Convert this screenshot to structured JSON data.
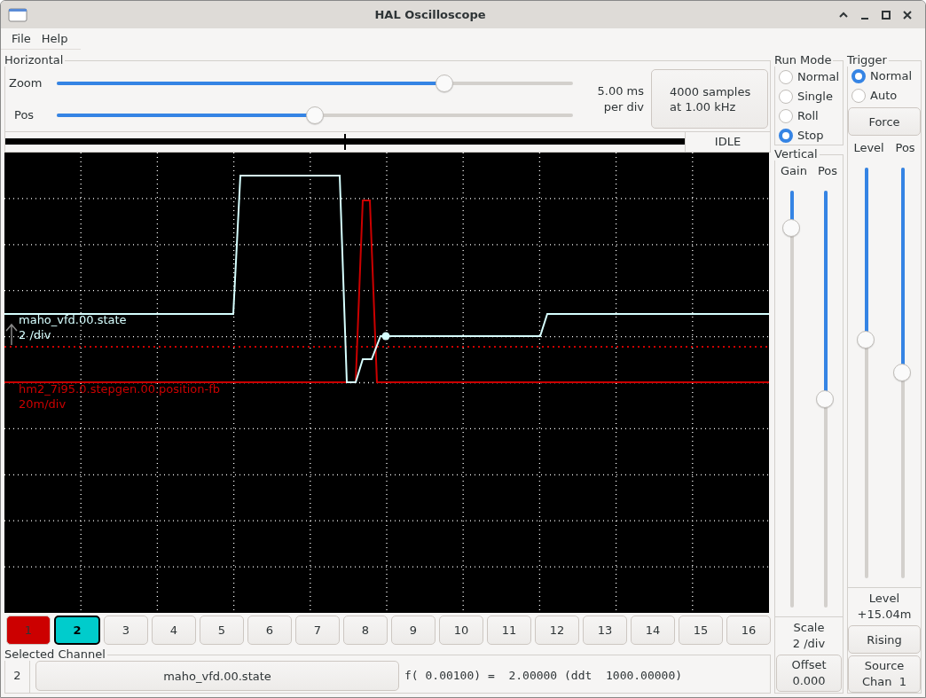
{
  "window": {
    "title": "HAL Oscilloscope"
  },
  "menu": [
    "File",
    "Help"
  ],
  "horizontal": {
    "title": "Horizontal",
    "sliders": [
      {
        "label": "Zoom",
        "level": 0.75
      },
      {
        "label": "Pos",
        "level": 0.5
      }
    ],
    "scale": "5.00 ms\nper div",
    "samples_button": "4000 samples\nat 1.00 kHz"
  },
  "status": "IDLE",
  "capture": {
    "level": 1
  },
  "traces": [
    {
      "name": "maho_vfd.00.state",
      "scale": "2 /div",
      "color": "#d6ffff"
    },
    {
      "name": "hm2_7i95.0.stepgen.00.position-fb",
      "scale": "20m/div",
      "color": "#cc0000"
    }
  ],
  "channels": [
    {
      "label": "1",
      "color": "#cc0000",
      "selected": false
    },
    {
      "label": "2",
      "color": "#00cccc",
      "selected": true
    },
    {
      "label": "3",
      "selected": false
    },
    {
      "label": "4",
      "selected": false
    },
    {
      "label": "5",
      "selected": false
    },
    {
      "label": "6",
      "selected": false
    },
    {
      "label": "7",
      "selected": false
    },
    {
      "label": "8",
      "selected": false
    },
    {
      "label": "9",
      "selected": false
    },
    {
      "label": "10",
      "selected": false
    },
    {
      "label": "11",
      "selected": false
    },
    {
      "label": "12",
      "selected": false
    },
    {
      "label": "13",
      "selected": false
    },
    {
      "label": "14",
      "selected": false
    },
    {
      "label": "15",
      "selected": false
    },
    {
      "label": "16",
      "selected": false
    }
  ],
  "selected_channel": {
    "title": "Selected Channel",
    "number": "2",
    "name_button": "maho_vfd.00.state",
    "readout": "f( 0.00100) =  2.00000 (ddt  1000.00000)"
  },
  "run_mode": {
    "title": "Run Mode",
    "options": [
      {
        "label": "Normal",
        "selected": false
      },
      {
        "label": "Single",
        "selected": false
      },
      {
        "label": "Roll",
        "selected": false
      },
      {
        "label": "Stop",
        "selected": true
      }
    ]
  },
  "vertical": {
    "title": "Vertical",
    "sliders": [
      {
        "label": "Gain",
        "level": 0.09
      },
      {
        "label": "Pos",
        "level": 0.5
      }
    ],
    "scale": "Scale\n2 /div",
    "offset_button": "Offset\n0.000"
  },
  "trigger": {
    "title": "Trigger",
    "options": [
      {
        "label": "Normal",
        "selected": true
      },
      {
        "label": "Auto",
        "selected": false
      }
    ],
    "force_button": "Force",
    "sliders": [
      {
        "label": "Level",
        "level": 0.42
      },
      {
        "label": "Pos",
        "level": 0.5
      }
    ],
    "level_readout": "Level\n+15.04m",
    "edge_button": "Rising",
    "source_button": "Source\nChan  1"
  }
}
